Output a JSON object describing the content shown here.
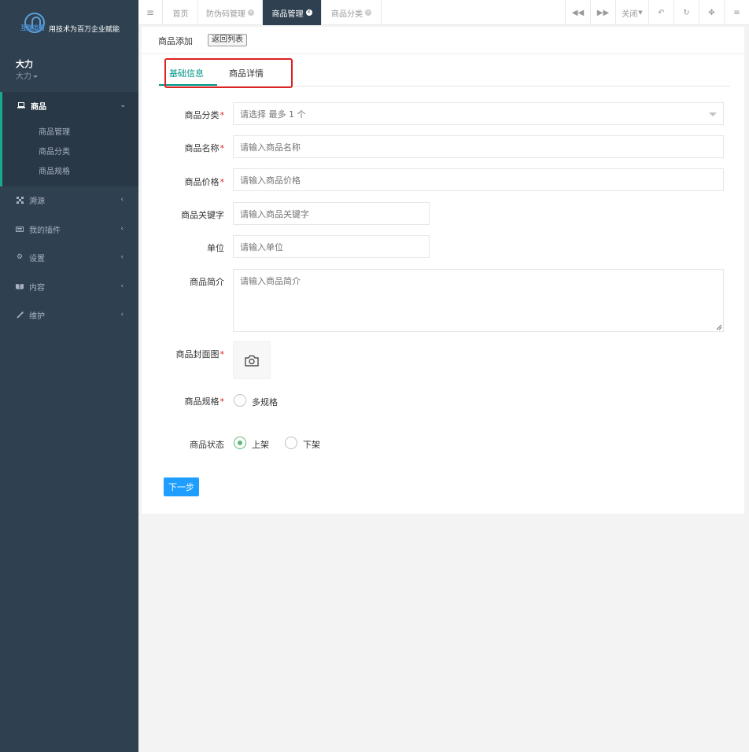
{
  "logo": {
    "brand": "互联追溯",
    "slogan": "用技术为百万企业赋能"
  },
  "user": {
    "name": "大力",
    "role": "大力"
  },
  "sidebar": {
    "items": [
      {
        "label": "商品",
        "icon": "laptop-icon"
      },
      {
        "label": "溯源",
        "icon": "qrcode-icon"
      },
      {
        "label": "我的插件",
        "icon": "keyboard-icon"
      },
      {
        "label": "设置",
        "icon": "gear-icon"
      },
      {
        "label": "内容",
        "icon": "book-icon"
      },
      {
        "label": "维护",
        "icon": "magic-wand-icon"
      }
    ],
    "sub_items": [
      "商品管理",
      "商品分类",
      "商品规格"
    ]
  },
  "topbar": {
    "tabs": [
      {
        "label": "首页"
      },
      {
        "label": "防伪码管理"
      },
      {
        "label": "商品管理"
      },
      {
        "label": "商品分类"
      }
    ],
    "close_label": "关闭"
  },
  "panel": {
    "title": "商品添加",
    "back_label": "返回列表"
  },
  "form_tabs": [
    "基础信息",
    "商品详情"
  ],
  "form": {
    "category": {
      "label": "商品分类",
      "placeholder": "请选择 最多 1 个"
    },
    "name": {
      "label": "商品名称",
      "placeholder": "请输入商品名称"
    },
    "price": {
      "label": "商品价格",
      "placeholder": "请输入商品价格"
    },
    "keyword": {
      "label": "商品关键字",
      "placeholder": "请输入商品关键字"
    },
    "unit": {
      "label": "单位",
      "placeholder": "请输入单位"
    },
    "intro": {
      "label": "商品简介",
      "placeholder": "请输入商品简介"
    },
    "cover": {
      "label": "商品封面图"
    },
    "spec": {
      "label": "商品规格",
      "option": "多规格"
    },
    "status": {
      "label": "商品状态",
      "options": [
        "上架",
        "下架"
      ],
      "selected": "上架"
    },
    "next_label": "下一步"
  },
  "colors": {
    "sidebar": "#2f4050",
    "accent": "#009688",
    "primary_button": "#1e9fff",
    "required": "#e02020"
  }
}
